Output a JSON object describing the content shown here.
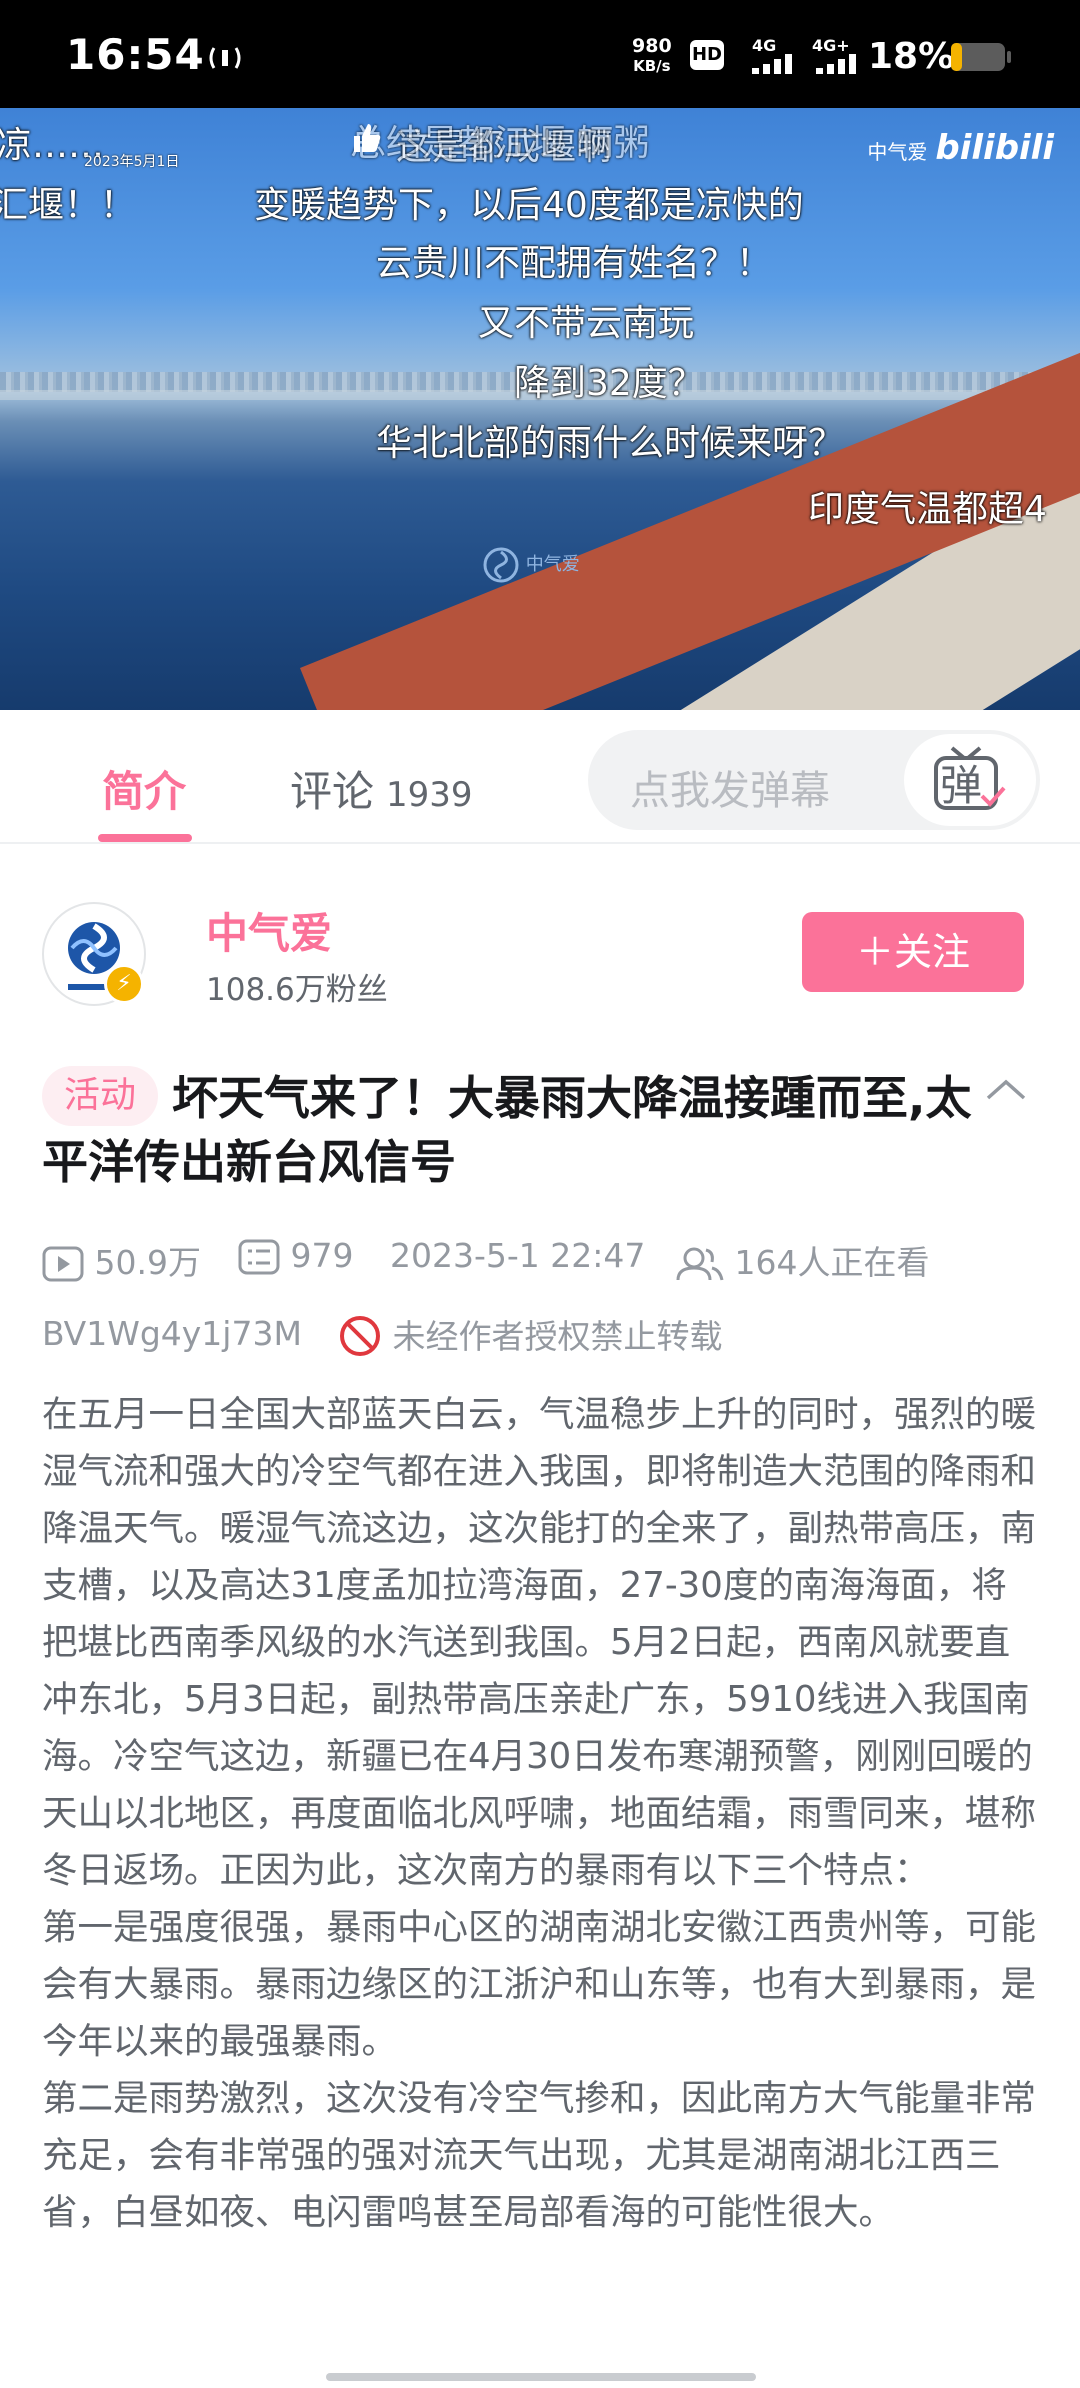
{
  "status_bar": {
    "time": "16:54",
    "net_speed_value": "980",
    "net_speed_unit": "KB/s",
    "signal_1": "HD",
    "signal_2": "4G",
    "signal_3": "4G+",
    "battery": "18%",
    "icons": [
      "nfc-icon",
      "hd-icon",
      "signal-icon",
      "battery-icon"
    ]
  },
  "video": {
    "danmaku": [
      "凉……",
      "汇堰！！",
      "这是都成堰啊",
      "总结是都江堰 辆粥",
      "变暖趋势下，以后40度都是凉快的",
      "云贵川不配拥有姓名？！",
      "又不带云南玩",
      "降到32度？",
      "华北北部的雨什么时候来呀？",
      "印度气温都超4"
    ],
    "date_stamp": "2023年5月1日",
    "watermark": "中气爱",
    "logo_small": "中气爱",
    "logo_brand": "bilibili",
    "progress": 0.96
  },
  "tabs": {
    "intro": "简介",
    "comment": "评论",
    "comment_count": "1939",
    "danmaku_placeholder": "点我发弹幕",
    "danmaku_glyph": "弹"
  },
  "uploader": {
    "name": "中气爱",
    "fans": "108.6万粉丝",
    "follow_label": "关注",
    "follow_plus": "＋"
  },
  "video_info": {
    "tag": "活动",
    "title": "坏天气来了！大暴雨大降温接踵而至,太平洋传出新台风信号",
    "views": "50.9万",
    "danmaku_count": "979",
    "pubdate": "2023-5-1 22:47",
    "watching": "164人正在看",
    "bvid": "BV1Wg4y1j73M",
    "no_repost": "未经作者授权禁止转载"
  },
  "description": [
    "在五月一日全国大部蓝天白云，气温稳步上升的同时，强烈的暖湿气流和强大的冷空气都在进入我国，即将制造大范围的降雨和降温天气。暖湿气流这边，这次能打的全来了，副热带高压，南支槽，以及高达31度孟加拉湾海面，27-30度的南海海面，将把堪比西南季风级的水汽送到我国。5月2日起，西南风就要直冲东北，5月3日起，副热带高压亲赴广东，5910线进入我国南海。冷空气这边，新疆已在4月30日发布寒潮预警，刚刚回暖的天山以北地区，再度面临北风呼啸，地面结霜，雨雪同来，堪称冬日返场。正因为此，这次南方的暴雨有以下三个特点：",
    "第一是强度很强，暴雨中心区的湖南湖北安徽江西贵州等，可能会有大暴雨。暴雨边缘区的江浙沪和山东等，也有大到暴雨，是今年以来的最强暴雨。",
    "第二是雨势激烈，这次没有冷空气掺和，因此南方大气能量非常充足，会有非常强的强对流天气出现，尤其是湖南湖北江西三省，白昼如夜、电闪雷鸣甚至局部看海的可能性很大。"
  ],
  "colors": {
    "accent": "#fb7299",
    "text_primary": "#18191c",
    "text_secondary": "#61666d",
    "text_muted": "#9499a0"
  }
}
